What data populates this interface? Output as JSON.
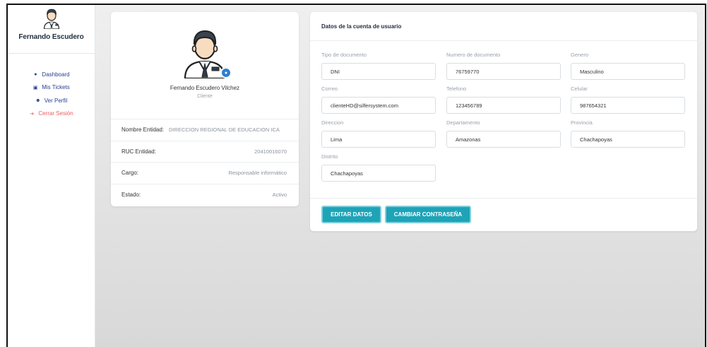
{
  "sidebar": {
    "user_name": "Fernando Escudero",
    "items": [
      {
        "label": "Dashboard",
        "icon": "home-icon"
      },
      {
        "label": "Mis Tickets",
        "icon": "ticket-icon"
      },
      {
        "label": "Ver Perfil",
        "icon": "users-icon"
      },
      {
        "label": "Cerrar Sesión",
        "icon": "logout-icon"
      }
    ]
  },
  "profile": {
    "full_name": "Fernando Escudero Vilchez",
    "role": "Cliente",
    "rows": [
      {
        "label": "Nombre Entidad:",
        "value": "DIRECCION REGIONAL DE EDUCACION ICA"
      },
      {
        "label": "RUC Entidad:",
        "value": "20410016070"
      },
      {
        "label": "Cargo:",
        "value": "Responsable informático"
      },
      {
        "label": "Estado:",
        "value": "Activo"
      }
    ]
  },
  "account": {
    "title": "Datos de la cuenta de usuario",
    "fields": [
      {
        "label": "Tipo de documento",
        "value": "DNI"
      },
      {
        "label": "Numero de documento",
        "value": "76759770"
      },
      {
        "label": "Genero",
        "value": "Masculino"
      },
      {
        "label": "Correo",
        "value": "clienteHD@silfersystem.com"
      },
      {
        "label": "Telefono",
        "value": "123456789"
      },
      {
        "label": "Celular",
        "value": "987654321"
      },
      {
        "label": "Direccion",
        "value": "Lima"
      },
      {
        "label": "Departamento",
        "value": "Amazonas"
      },
      {
        "label": "Provincia",
        "value": "Chachapoyas"
      },
      {
        "label": "Distrito",
        "value": "Chachapoyas"
      }
    ],
    "edit_label": "EDITAR DATOS",
    "password_label": "CAMBIAR CONTRASEÑA"
  },
  "colors": {
    "accent": "#1ea3b7",
    "nav_text": "#2a3f8f",
    "logout_text": "#ef5b5b",
    "camera_badge": "#2f80d0"
  }
}
